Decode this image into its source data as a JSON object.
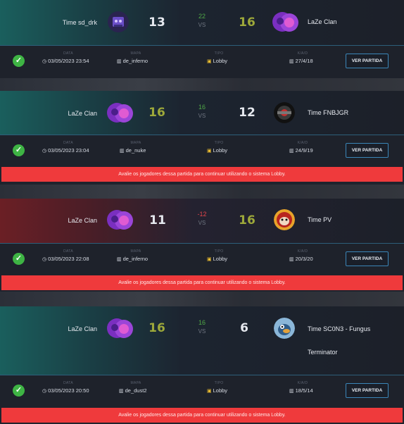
{
  "labels": {
    "data": "DATA",
    "mapa": "MAPA",
    "tipo": "TIPO",
    "kad": "K/A/D",
    "view": "VER PARTIDA"
  },
  "alert_text": "Avalie os jogadores dessa partida para continuar utilizando o sistema Lobby.",
  "matches": [
    {
      "left_team": "Time sd_drk",
      "left_score": "13",
      "diff": "22",
      "vs": "VS",
      "right_score": "16",
      "right_team": "LaZe Clan",
      "date": "03/05/2023 23:54",
      "map": "de_inferno",
      "type": "Lobby",
      "kad": "27/4/18"
    },
    {
      "left_team": "LaZe Clan",
      "left_score": "16",
      "diff": "16",
      "vs": "VS",
      "right_score": "12",
      "right_team": "Time FNBJGR",
      "date": "03/05/2023 23:04",
      "map": "de_nuke",
      "type": "Lobby",
      "kad": "24/9/19"
    },
    {
      "left_team": "LaZe Clan",
      "left_score": "11",
      "diff": "-12",
      "vs": "VS",
      "right_score": "16",
      "right_team": "Time PV",
      "date": "03/05/2023 22:08",
      "map": "de_inferno",
      "type": "Lobby",
      "kad": "20/3/20"
    },
    {
      "left_team": "LaZe Clan",
      "left_score": "16",
      "diff": "16",
      "vs": "VS",
      "right_score": "6",
      "right_team": "Time SC0N3 - Fungus",
      "right_team_line2": "Terminator",
      "date": "03/05/2023 20:50",
      "map": "de_dust2",
      "type": "Lobby",
      "kad": "18/5/14"
    }
  ],
  "colors": {
    "win": "#9ea93a",
    "diff_pos": "#4fa846",
    "diff_neg": "#e5454b",
    "alert": "#ef3a3c",
    "check": "#3eb444"
  }
}
